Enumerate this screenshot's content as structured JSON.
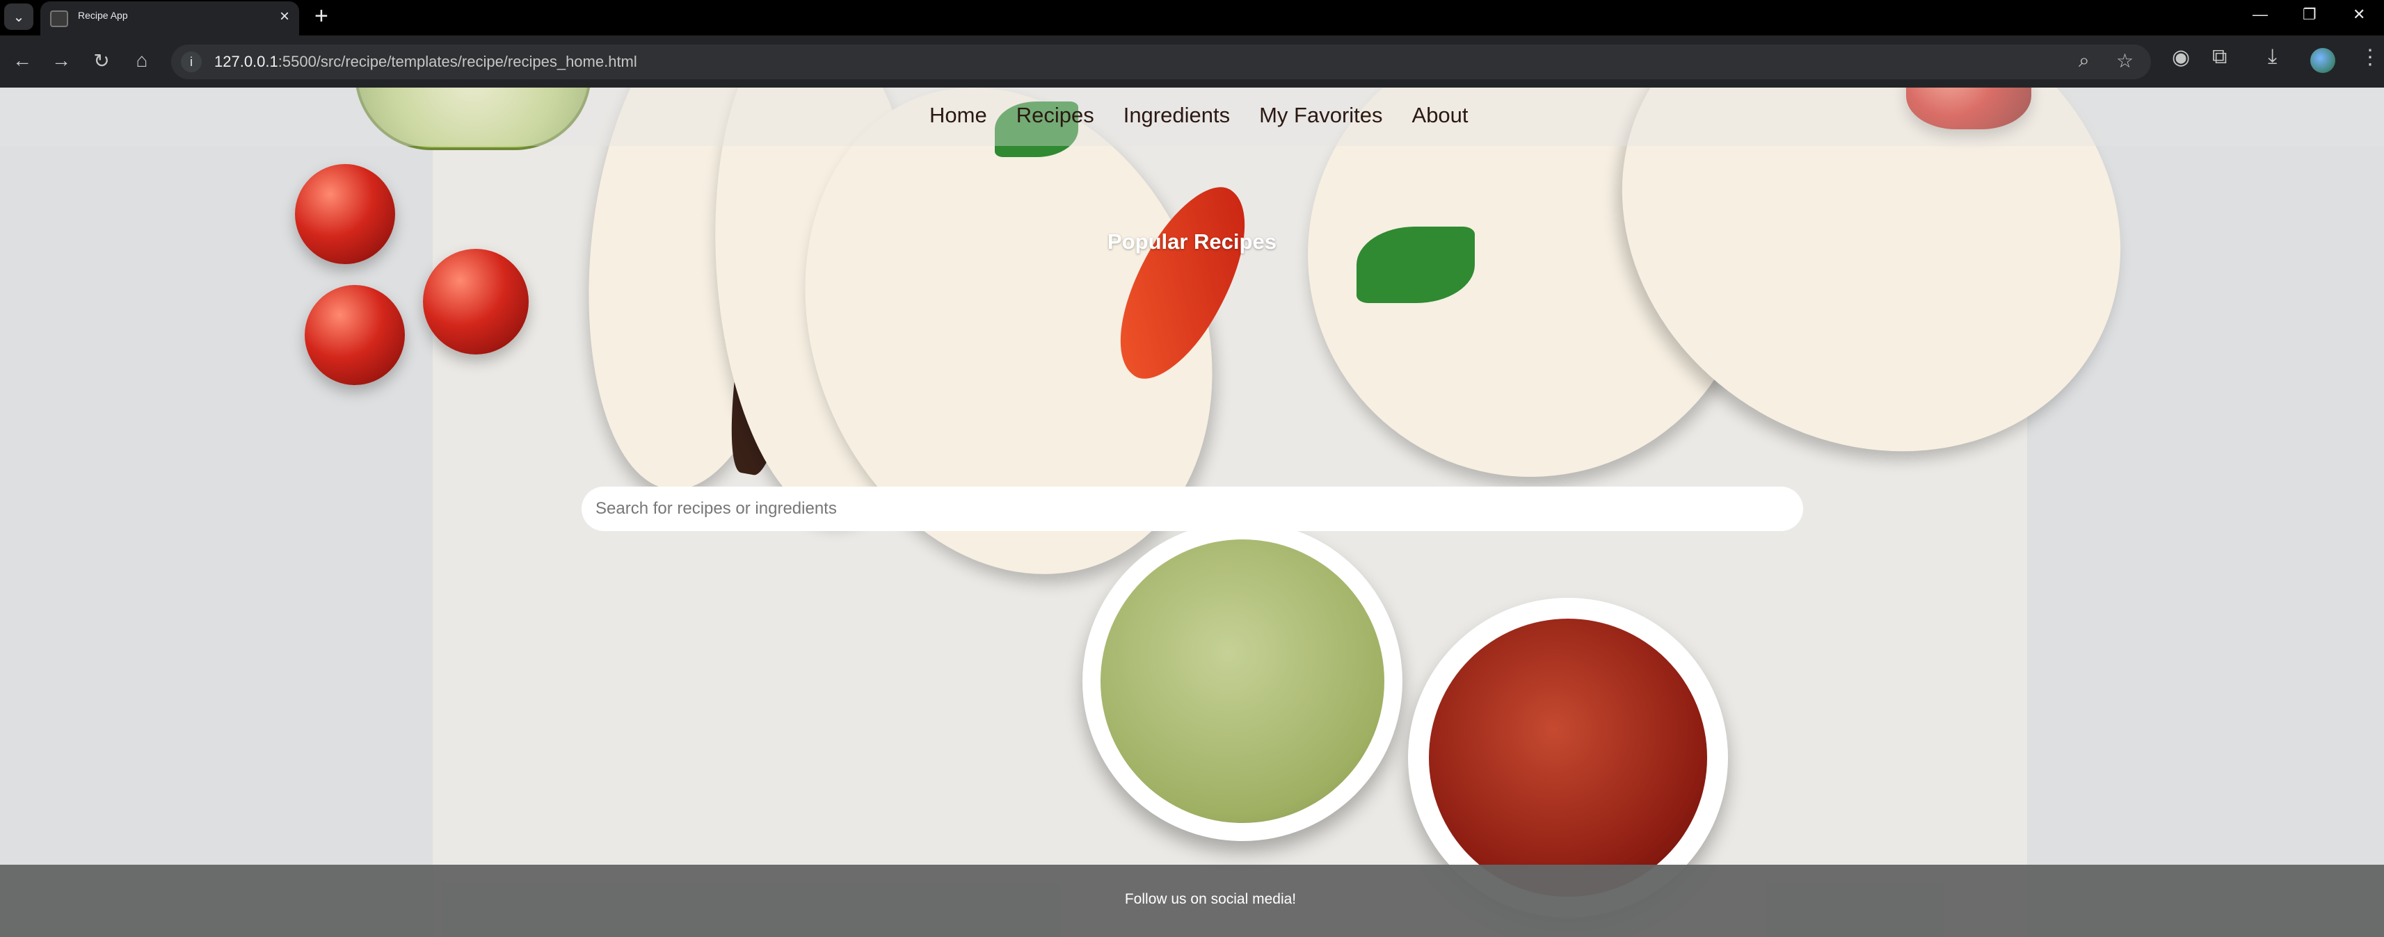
{
  "browser": {
    "tab_title": "Recipe App",
    "url_host": "127.0.0.1",
    "url_rest": ":5500/src/recipe/templates/recipe/recipes_home.html"
  },
  "nav": {
    "items": [
      {
        "label": "Home"
      },
      {
        "label": "Recipes"
      },
      {
        "label": "Ingredients"
      },
      {
        "label": "My Favorites"
      },
      {
        "label": "About"
      }
    ]
  },
  "hero": {
    "title": "Popular Recipes"
  },
  "search": {
    "placeholder": "Search for recipes or ingredients",
    "value": ""
  },
  "footer": {
    "text": "Follow us on social media!"
  },
  "colors": {
    "nav_link": "#2b1812",
    "footer_bg": "#656666",
    "page_bg": "#dedfe0"
  }
}
